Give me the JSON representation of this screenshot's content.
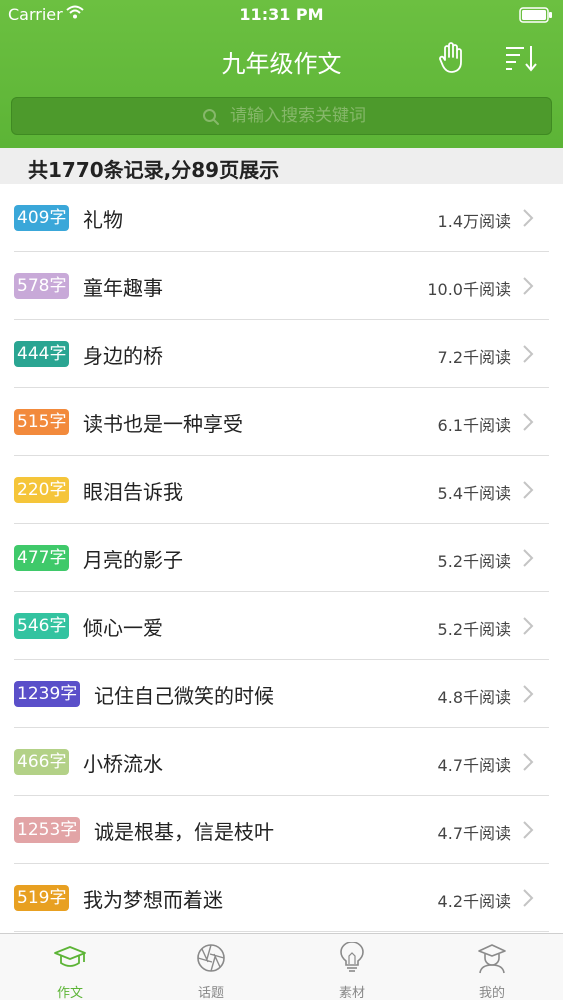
{
  "status_bar": {
    "carrier": "Carrier",
    "time": "11:31 PM"
  },
  "header": {
    "title": "九年级作文"
  },
  "search": {
    "placeholder": "请输入搜索关键词"
  },
  "summary": {
    "text": "共1770条记录,分89页展示"
  },
  "colors": {
    "accent": "#5cb436",
    "search_bg": "#4d9a2c"
  },
  "articles": [
    {
      "badge": "409字",
      "badge_color": "#3aa7d9",
      "title": "礼物",
      "reads": "1.4万阅读"
    },
    {
      "badge": "578字",
      "badge_color": "#c8a9d8",
      "title": "童年趣事",
      "reads": "10.0千阅读"
    },
    {
      "badge": "444字",
      "badge_color": "#2aa592",
      "title": "身边的桥",
      "reads": "7.2千阅读"
    },
    {
      "badge": "515字",
      "badge_color": "#f28a3c",
      "title": "读书也是一种享受",
      "reads": "6.1千阅读"
    },
    {
      "badge": "220字",
      "badge_color": "#f5c53a",
      "title": "眼泪告诉我",
      "reads": "5.4千阅读"
    },
    {
      "badge": "477字",
      "badge_color": "#3fc96a",
      "title": "月亮的影子",
      "reads": "5.2千阅读"
    },
    {
      "badge": "546字",
      "badge_color": "#33c3a0",
      "title": "倾心一爱",
      "reads": "5.2千阅读"
    },
    {
      "badge": "1239字",
      "badge_color": "#5a4fc9",
      "title": "记住自己微笑的时候",
      "reads": "4.8千阅读"
    },
    {
      "badge": "466字",
      "badge_color": "#b3d187",
      "title": "小桥流水",
      "reads": "4.7千阅读"
    },
    {
      "badge": "1253字",
      "badge_color": "#e2a4a6",
      "title": "诚是根基，信是枝叶",
      "reads": "4.7千阅读"
    },
    {
      "badge": "519字",
      "badge_color": "#e8a021",
      "title": "我为梦想而着迷",
      "reads": "4.2千阅读"
    }
  ],
  "tabs": [
    {
      "label": "作文",
      "icon": "graduation-cap-icon",
      "active": true
    },
    {
      "label": "话题",
      "icon": "aperture-icon",
      "active": false
    },
    {
      "label": "素材",
      "icon": "lightbulb-icon",
      "active": false
    },
    {
      "label": "我的",
      "icon": "profile-icon",
      "active": false
    }
  ]
}
